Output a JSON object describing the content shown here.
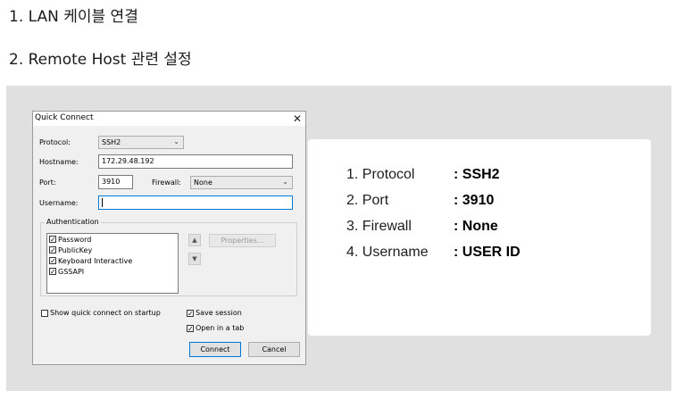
{
  "headings": {
    "step1": "1.  LAN 케이블 연결",
    "step2": "2.  Remote Host 관련 설정"
  },
  "dialog": {
    "title": "Quick Connect",
    "close_glyph": "✕",
    "protocol_label": "Protocol:",
    "protocol_value": "SSH2",
    "hostname_label": "Hostname:",
    "hostname_value": "172.29.48.192",
    "port_label": "Port:",
    "port_value": "3910",
    "firewall_label": "Firewall:",
    "firewall_value": "None",
    "username_label": "Username:",
    "username_value": "",
    "auth_group_label": "Authentication",
    "auth_methods": [
      {
        "label": "Password",
        "checked": true
      },
      {
        "label": "PublicKey",
        "checked": true
      },
      {
        "label": "Keyboard Interactive",
        "checked": true
      },
      {
        "label": "GSSAPI",
        "checked": true
      }
    ],
    "properties_label": "Properties...",
    "show_quick_connect_label": "Show quick connect on startup",
    "show_quick_connect_checked": false,
    "save_session_label": "Save session",
    "save_session_checked": true,
    "open_in_tab_label": "Open in a tab",
    "open_in_tab_checked": true,
    "connect_label": "Connect",
    "cancel_label": "Cancel",
    "up_icon": "triangle-up-icon",
    "down_icon": "triangle-down-icon",
    "chevron_icon": "chevron-down-icon"
  },
  "summary": [
    {
      "key": "1. Protocol",
      "value": ": SSH2"
    },
    {
      "key": "2. Port",
      "value": ": 3910"
    },
    {
      "key": "3. Firewall",
      "value": ": None"
    },
    {
      "key": "4. Username",
      "value": ": USER ID"
    }
  ]
}
